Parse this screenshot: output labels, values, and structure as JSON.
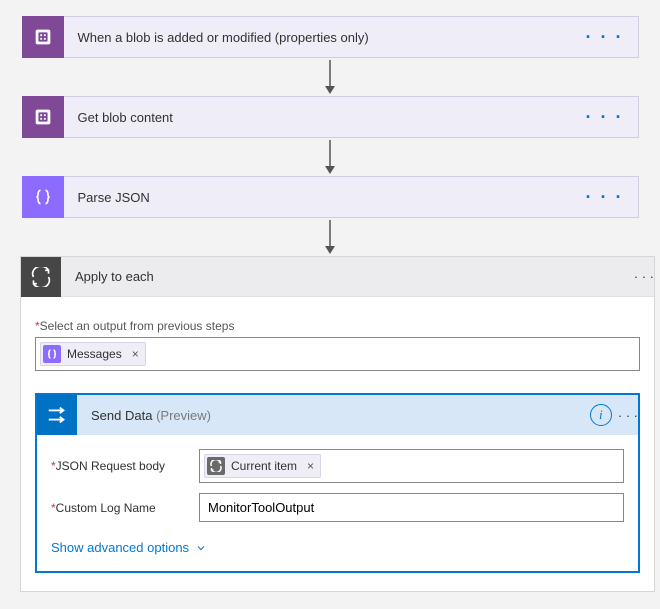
{
  "steps": {
    "trigger": {
      "title": "When a blob is added or modified (properties only)"
    },
    "getBlob": {
      "title": "Get blob content"
    },
    "parseJson": {
      "title": "Parse JSON"
    }
  },
  "applyToEach": {
    "title": "Apply to each",
    "selectOutputLabel": "Select an output from previous steps",
    "tokens": {
      "messages": "Messages"
    }
  },
  "sendData": {
    "title": "Send Data",
    "previewTag": "(Preview)",
    "fields": {
      "jsonBodyLabel": "JSON Request body",
      "jsonBodyToken": "Current item",
      "customLogLabel": "Custom Log Name",
      "customLogValue": "MonitorToolOutput"
    },
    "advancedLink": "Show advanced options"
  },
  "glyphs": {
    "ellipsis": "· · ·"
  }
}
